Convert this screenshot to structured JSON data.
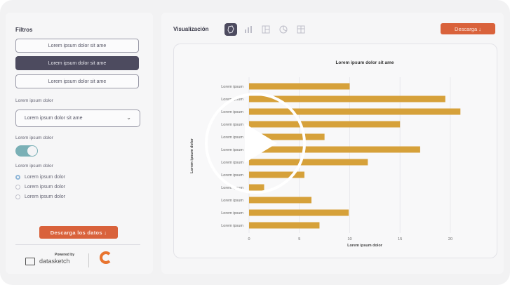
{
  "sidebar": {
    "filters_title": "Filtros",
    "filter_buttons": [
      "Lorem ipsum dolor sit ame",
      "Lorem ipsum dolor sit ame",
      "Lorem ipsum dolor sit ame"
    ],
    "select_label": "Lorem ipsum dolor",
    "select_value": "Lorem ipsum dolor sit ame",
    "toggle_label": "Lorem ipsum dolor",
    "toggle_on": true,
    "radio_label": "Lorem ipsum dolor",
    "radio_options": [
      "Lorem ipsum dolor",
      "Lorem ipsum dolor",
      "Lorem ipsum dolor"
    ],
    "download_label": "Descarga los datos ↓",
    "powered_by": "Powered by",
    "brand": "datasketch"
  },
  "main": {
    "title": "Visualización",
    "download_label": "Descarga ↓",
    "icons": [
      "map-icon",
      "bar-chart-icon",
      "treemap-icon",
      "pie-icon",
      "table-icon"
    ]
  },
  "colors": {
    "accent": "#d9623b",
    "bar": "#d6a13a",
    "dark": "#4d4b5f"
  },
  "chart_data": {
    "type": "bar",
    "orientation": "horizontal",
    "title": "Lorem ipsum dolor sit ame",
    "xlabel": "Lorem ipsum dolor",
    "ylabel": "Lorem ipsum dolor",
    "categories": [
      "Lorem ipsum",
      "Lorem ipsum",
      "Lorem ipsum",
      "Lorem ipsum",
      "Lorem ipsum",
      "Lorem ipsum",
      "Lorem ipsum",
      "Lorem ipsum",
      "Lorem ipsum",
      "Lorem ipsum",
      "Lorem ipsum",
      "Lorem ipsum"
    ],
    "values": [
      10,
      19.5,
      21,
      15,
      7.5,
      17,
      11.8,
      5.5,
      1.5,
      6.2,
      9.9,
      7
    ],
    "xticks": [
      0,
      5,
      10,
      15,
      20
    ],
    "xlim": [
      0,
      23
    ],
    "grid": true
  }
}
